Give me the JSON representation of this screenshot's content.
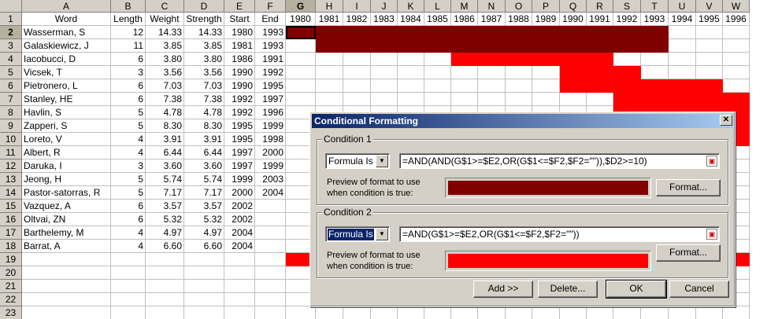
{
  "sheet": {
    "columns": [
      "A",
      "B",
      "C",
      "D",
      "E",
      "F",
      "G",
      "H",
      "I",
      "J",
      "K",
      "L",
      "M",
      "N",
      "O",
      "P",
      "Q",
      "R",
      "S",
      "T",
      "U",
      "V",
      "W"
    ],
    "header_row": [
      "Word",
      "Length",
      "Weight",
      "Strength",
      "Start",
      "End",
      "1980",
      "1981",
      "1982",
      "1983",
      "1984",
      "1985",
      "1986",
      "1987",
      "1988",
      "1989",
      "1990",
      "1991",
      "1992",
      "1993",
      "1994",
      "1995",
      "1996"
    ],
    "rows": [
      [
        "Wasserman, S",
        "12",
        "14.33",
        "14.33",
        "1980",
        "1993"
      ],
      [
        "Galaskiewicz, J",
        "11",
        "3.85",
        "3.85",
        "1981",
        "1993"
      ],
      [
        "Iacobucci, D",
        "6",
        "3.80",
        "3.80",
        "1986",
        "1991"
      ],
      [
        "Vicsek, T",
        "3",
        "3.56",
        "3.56",
        "1990",
        "1992"
      ],
      [
        "Pietronero, L",
        "6",
        "7.03",
        "7.03",
        "1990",
        "1995"
      ],
      [
        "Stanley, HE",
        "6",
        "7.38",
        "7.38",
        "1992",
        "1997"
      ],
      [
        "Havlin, S",
        "5",
        "4.78",
        "4.78",
        "1992",
        "1996"
      ],
      [
        "Zapperi, S",
        "5",
        "8.30",
        "8.30",
        "1995",
        "1999"
      ],
      [
        "Loreto, V",
        "4",
        "3.91",
        "3.91",
        "1995",
        "1998"
      ],
      [
        "Albert, R",
        "4",
        "6.44",
        "6.44",
        "1997",
        "2000"
      ],
      [
        "Daruka, I",
        "3",
        "3.60",
        "3.60",
        "1997",
        "1999"
      ],
      [
        "Jeong, H",
        "5",
        "5.74",
        "5.74",
        "1999",
        "2003"
      ],
      [
        "Pastor-satorras, R",
        "5",
        "7.17",
        "7.17",
        "2000",
        "2004"
      ],
      [
        "Vazquez, A",
        "6",
        "3.57",
        "3.57",
        "2002",
        ""
      ],
      [
        "Oltvai, ZN",
        "6",
        "5.32",
        "5.32",
        "2002",
        ""
      ],
      [
        "Barthelemy, M",
        "4",
        "4.97",
        "4.97",
        "2004",
        ""
      ],
      [
        "Barrat, A",
        "4",
        "6.60",
        "6.60",
        "2004",
        ""
      ]
    ],
    "row_numbers": [
      "1",
      "2",
      "3",
      "4",
      "5",
      "6",
      "7",
      "8",
      "9",
      "10",
      "11",
      "12",
      "13",
      "14",
      "15",
      "16",
      "17",
      "18",
      "19",
      "20",
      "21",
      "22",
      "23"
    ],
    "selected_cell": "G2",
    "colors": {
      "dark_red": "#800000",
      "red": "#ff0000",
      "header_bg": "#d4d0c8"
    }
  },
  "dialog": {
    "title": "Conditional Formatting",
    "close_icon": "close-icon",
    "condition1": {
      "label": "Condition 1",
      "type": "Formula Is",
      "formula": "=AND(AND(G$1>=$E2,OR(G$1<=$F2,$F2=\"\")),$D2>=10)",
      "preview_label": "Preview of format to use\nwhen condition is true:",
      "format_button": "Format...",
      "preview_color": "#800000"
    },
    "condition2": {
      "label": "Condition 2",
      "type": "Formula Is",
      "formula": "=AND(G$1>=$E2,OR(G$1<=$F2,$F2=\"\"))",
      "preview_label": "Preview of format to use\nwhen condition is true:",
      "format_button": "Format...",
      "preview_color": "#ff0000"
    },
    "buttons": {
      "add": "Add >>",
      "delete": "Delete...",
      "ok": "OK",
      "cancel": "Cancel"
    }
  }
}
